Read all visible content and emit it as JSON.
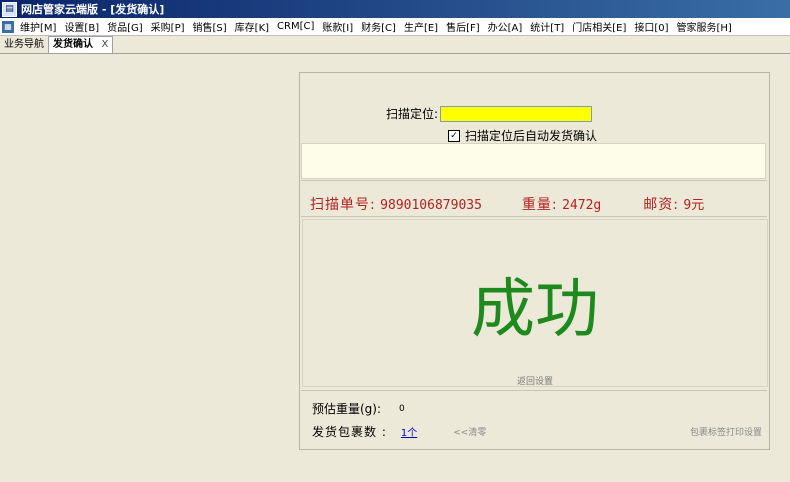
{
  "window": {
    "title": "网店管家云端版 - [发货确认]",
    "icon": "app-icon"
  },
  "menubar": {
    "items": [
      "维护[M]",
      "设置[B]",
      "货品[G]",
      "采购[P]",
      "销售[S]",
      "库存[K]",
      "CRM[C]",
      "账款[I]",
      "财务[C]",
      "生产[E]",
      "售后[F]",
      "办公[A]",
      "统计[T]",
      "门店相关[E]",
      "接口[0]",
      "管家服务[H]"
    ]
  },
  "tabs": [
    {
      "label": "业务导航",
      "active": false
    },
    {
      "label": "发货确认",
      "active": true,
      "close": "X"
    }
  ],
  "scan": {
    "label": "扫描定位:",
    "value": "",
    "input_color": "#ffff00",
    "auto_confirm_checked": true,
    "auto_confirm_mark": "✓",
    "auto_confirm_label": "扫描定位后自动发货确认"
  },
  "info": {
    "order_label": "扫描单号:",
    "order_value": "9890106879035",
    "weight_label": "重量:",
    "weight_value": "2472g",
    "postage_label": "邮资:",
    "postage_value": "9元",
    "color": "#b22222"
  },
  "result": {
    "text": "成功",
    "color": "#1e8a1e",
    "return_link": "返回设置"
  },
  "footer": {
    "est_weight_label": "预估重量(g):",
    "est_weight_value": "0",
    "package_label": "发货包裹数 :",
    "package_count": "1个",
    "clear_label": "<<清零",
    "print_settings_label": "包裹标签打印设置"
  }
}
